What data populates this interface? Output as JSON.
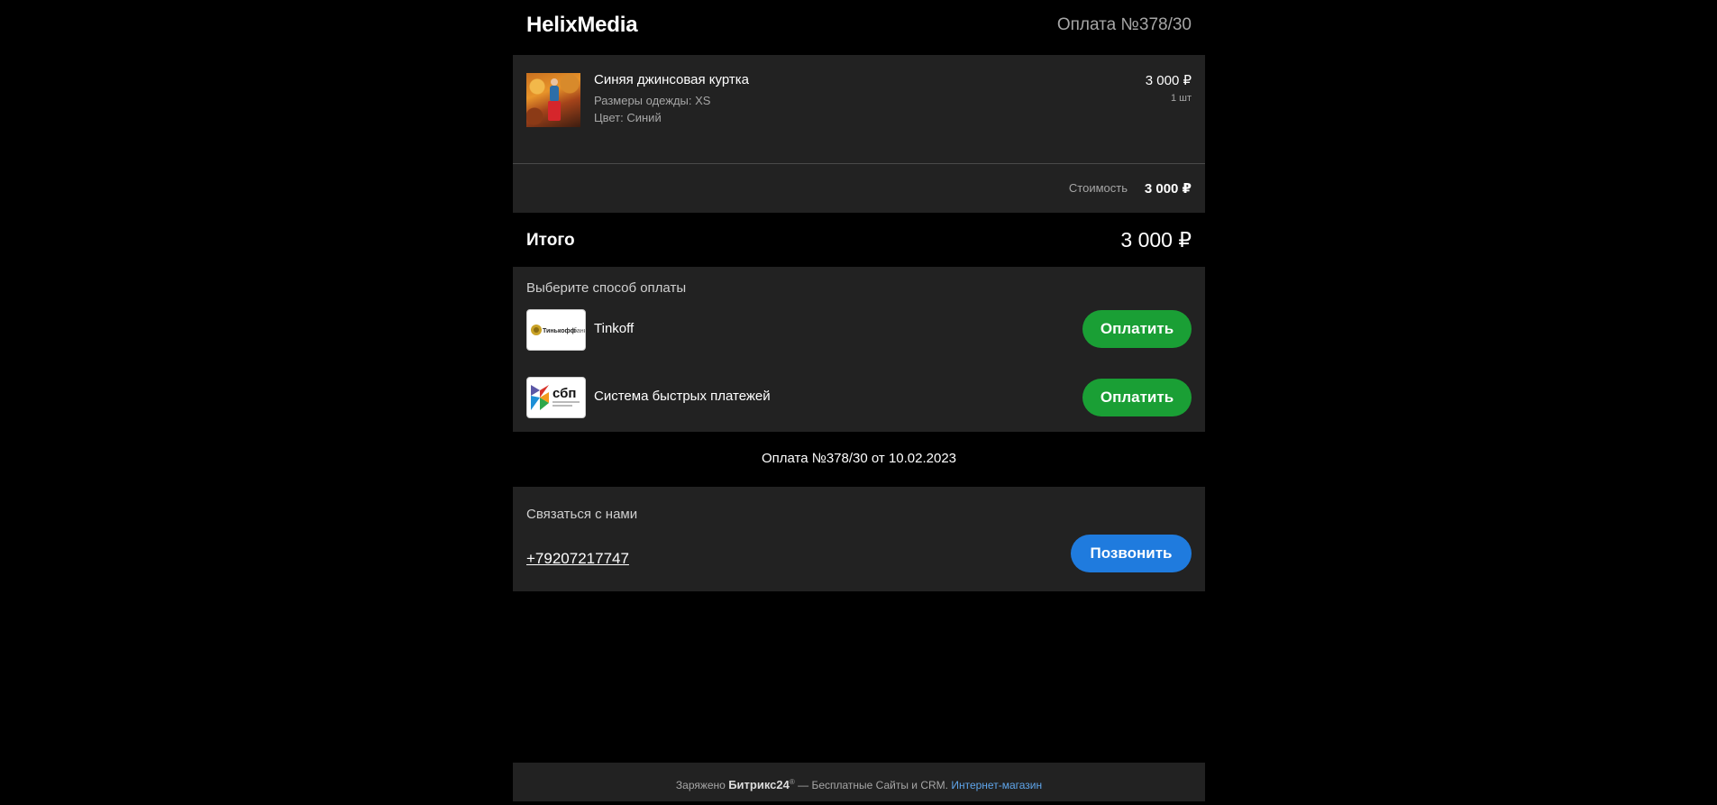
{
  "header": {
    "brand": "HelixMedia",
    "order_title": "Оплата №378/30"
  },
  "product": {
    "name": "Синяя джинсовая куртка",
    "props": [
      "Размеры одежды: XS",
      "Цвет: Синий"
    ],
    "price": "3 000 ₽",
    "quantity": "1  шт"
  },
  "cost": {
    "label": "Стоимость",
    "value": "3 000 ₽"
  },
  "total": {
    "label": "Итого",
    "value": "3 000 ₽"
  },
  "payment": {
    "title": "Выберите способ оплаты",
    "methods": [
      {
        "name": "Tinkoff",
        "logo_text": "Тинькофф",
        "button": "Оплатить"
      },
      {
        "name": "Система быстрых платежей",
        "logo_text": "сбп",
        "button": "Оплатить"
      }
    ]
  },
  "payment_date": "Оплата №378/30 от 10.02.2023",
  "contact": {
    "title": "Связаться с нами",
    "phone": "+79207217747",
    "call_button": "Позвонить"
  },
  "footer": {
    "prefix": "Заряжено",
    "brand": "Битрикс24",
    "reg": "®",
    "middle": " — Бесплатные Сайты и CRM.",
    "link": "Интернет-магазин"
  },
  "colors": {
    "background": "#000000",
    "panel": "#222222",
    "pay_button": "#1a9f35",
    "call_button": "#1f7bde",
    "link": "#5fa5ea"
  }
}
